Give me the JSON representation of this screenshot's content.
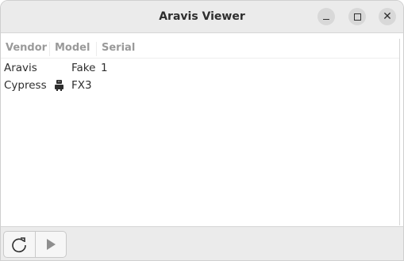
{
  "window": {
    "title": "Aravis Viewer"
  },
  "titlebar_buttons": [
    "minimize-icon",
    "maximize-icon",
    "close-icon"
  ],
  "table": {
    "columns": [
      "Vendor",
      "Model",
      "Serial"
    ],
    "rows": [
      {
        "vendor": "Aravis",
        "icon": null,
        "model": "Fake",
        "serial": "1"
      },
      {
        "vendor": "Cypress",
        "icon": "camera-icon",
        "model": "FX3",
        "serial": ""
      }
    ]
  },
  "toolbar": {
    "buttons": [
      {
        "name": "refresh-button",
        "icon": "refresh-icon"
      },
      {
        "name": "start-button",
        "icon": "play-icon"
      }
    ]
  }
}
